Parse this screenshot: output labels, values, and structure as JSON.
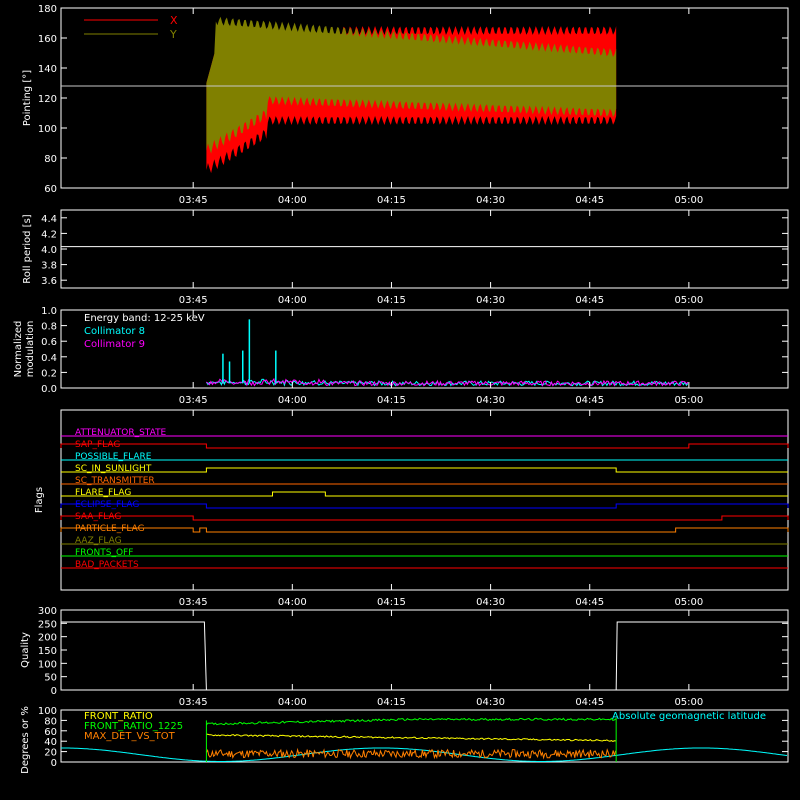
{
  "time_ticks": [
    "03:45",
    "04:00",
    "04:15",
    "04:30",
    "04:45",
    "05:00"
  ],
  "colors": {
    "axes": "#ffffff",
    "red": "#ff0000",
    "olive": "#808000",
    "cyan": "#00ffff",
    "magenta": "#ff00ff",
    "yellow": "#ffff00",
    "green": "#00ff00",
    "orange": "#ff8000",
    "blue": "#0000ff",
    "dark_orange": "#ff6600"
  },
  "chart_data": [
    {
      "id": "pointing",
      "type": "area",
      "ylabel": "Pointing [°]",
      "ylim": [
        60,
        180
      ],
      "yticks": [
        60,
        80,
        100,
        120,
        140,
        160,
        180
      ],
      "x_range": [
        "03:25",
        "05:15"
      ],
      "legend_position": "top-left",
      "series": [
        {
          "name": "X",
          "color": "#ff0000",
          "start": "03:47",
          "end": "04:49",
          "min_envelope_approx": [
            72,
            105
          ],
          "max_envelope_approx": [
            150,
            165
          ]
        },
        {
          "name": "Y",
          "color": "#808000",
          "start": "03:47",
          "end": "04:49",
          "min_envelope_approx": [
            85,
            120
          ],
          "max_envelope_approx": [
            150,
            172
          ]
        }
      ],
      "reference_line": 128
    },
    {
      "id": "roll",
      "type": "line",
      "ylabel": "Roll period [s]",
      "ylim": [
        3.5,
        4.5
      ],
      "yticks": [
        "3.6",
        "3.8",
        "4.0",
        "4.2",
        "4.4"
      ],
      "series": [
        {
          "name": "",
          "color": "#ffffff",
          "value": 4.03
        }
      ]
    },
    {
      "id": "modulation",
      "type": "line",
      "ylabel_lines": [
        "Normalized",
        "modulation"
      ],
      "ylim": [
        0,
        1.0
      ],
      "yticks": [
        "0.0",
        "0.2",
        "0.4",
        "0.6",
        "0.8",
        "1.0"
      ],
      "annotation": "Energy band: 12-25 keV",
      "series": [
        {
          "name": "Collimator 8",
          "color": "#00ffff"
        },
        {
          "name": "Collimator 9",
          "color": "#ff00ff"
        }
      ],
      "start": "03:47",
      "end": "05:00",
      "peaks": [
        {
          "time": "03:49.5",
          "value": 0.44
        },
        {
          "time": "03:50.5",
          "value": 0.34
        },
        {
          "time": "03:52.5",
          "value": 0.48
        },
        {
          "time": "03:53.5",
          "value": 0.88
        },
        {
          "time": "03:57.5",
          "value": 0.48
        }
      ],
      "baseline": 0.06
    },
    {
      "id": "flags",
      "type": "line",
      "ylabel": "Flags",
      "flags": [
        {
          "label": "ATTENUATOR_STATE",
          "color": "#ff00ff",
          "segments": []
        },
        {
          "label": "SAP_FLAG",
          "color": "#ff0000",
          "segments": [
            [
              "03:25",
              "03:47"
            ],
            [
              "05:00",
              "05:15"
            ]
          ]
        },
        {
          "label": "POSSIBLE_FLARE",
          "color": "#00ffff",
          "segments": []
        },
        {
          "label": "SC_IN_SUNLIGHT",
          "color": "#ffff00",
          "segments": [
            [
              "03:47",
              "04:49"
            ]
          ]
        },
        {
          "label": "SC_TRANSMITTER",
          "color": "#ff6600",
          "segments": []
        },
        {
          "label": "FLARE_FLAG",
          "color": "#ffff00",
          "segments": [
            [
              "03:57",
              "04:05"
            ]
          ]
        },
        {
          "label": "ECLIPSE_FLAG",
          "color": "#0000ff",
          "segments": [
            [
              "03:25",
              "03:47"
            ],
            [
              "04:49",
              "05:15"
            ]
          ]
        },
        {
          "label": "SAA_FLAG",
          "color": "#ff0000",
          "segments": [
            [
              "03:25",
              "03:45"
            ],
            [
              "05:05",
              "05:15"
            ]
          ]
        },
        {
          "label": "PARTICLE_FLAG",
          "color": "#ff8000",
          "segments": [
            [
              "03:25",
              "03:45"
            ],
            [
              "03:46",
              "03:47"
            ],
            [
              "04:58",
              "05:15"
            ]
          ]
        },
        {
          "label": "AAZ_FLAG",
          "color": "#808000",
          "segments": []
        },
        {
          "label": "FRONTS_OFF",
          "color": "#00ff00",
          "segments": []
        },
        {
          "label": "BAD_PACKETS",
          "color": "#ff0000",
          "segments": []
        }
      ]
    },
    {
      "id": "quality",
      "type": "line",
      "ylabel": "Quality",
      "ylim": [
        0,
        300
      ],
      "yticks": [
        "0",
        "50",
        "100",
        "150",
        "200",
        "250",
        "300"
      ],
      "series": [
        {
          "name": "",
          "color": "#ffffff",
          "high": 255,
          "low": 0,
          "low_start": "03:47",
          "low_end": "04:49"
        }
      ]
    },
    {
      "id": "ratios",
      "type": "line",
      "ylabel": "Degrees or %",
      "ylim": [
        0,
        100
      ],
      "yticks": [
        "0",
        "20",
        "40",
        "60",
        "80",
        "100"
      ],
      "series": [
        {
          "name": "FRONT_RATIO",
          "color": "#ffff00",
          "start_value": 52,
          "end_value": 41
        },
        {
          "name": "FRONT_RATIO_1225",
          "color": "#00ff00",
          "start_value": 73,
          "end_value": 82
        },
        {
          "name": "MAX_DET_VS_TOT",
          "color": "#ff8000",
          "mean": 16
        },
        {
          "name": "Absolute geomagnetic latitude",
          "color": "#00ffff"
        }
      ]
    }
  ]
}
